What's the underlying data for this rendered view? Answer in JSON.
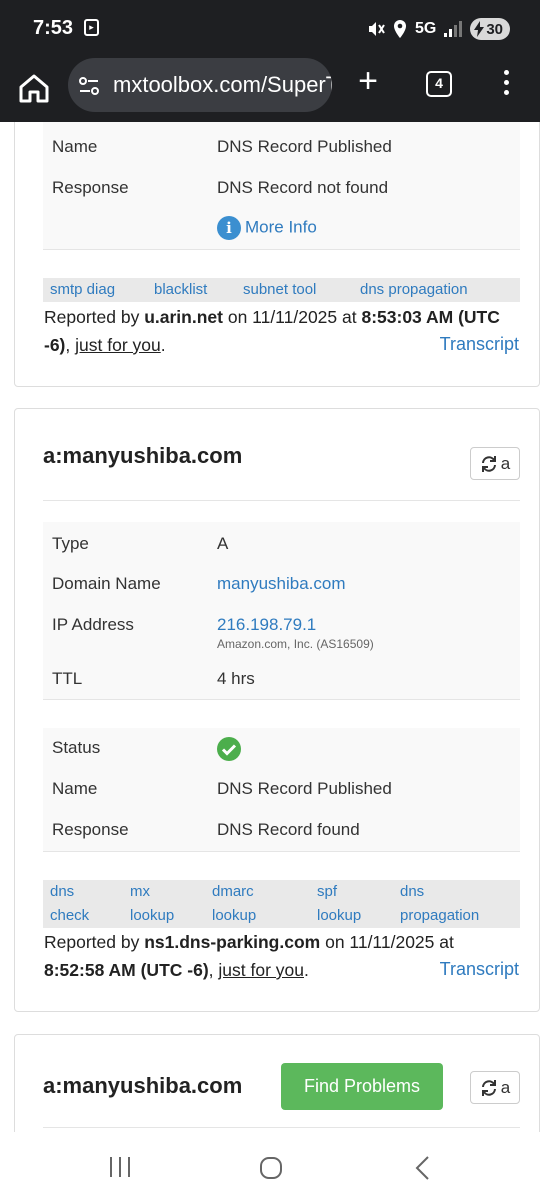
{
  "status_bar": {
    "time": "7:53",
    "network": "5G",
    "battery": "30"
  },
  "browser": {
    "url": "mxtoolbox.com/SuperTool",
    "tab_count": "4"
  },
  "card1": {
    "rows": [
      {
        "label": "Name",
        "value": "DNS Record Published"
      },
      {
        "label": "Response",
        "value": "DNS Record not found"
      }
    ],
    "more_info": "More Info",
    "links": [
      "smtp diag",
      "blacklist",
      "subnet tool",
      "dns propagation"
    ],
    "reported": {
      "prefix": "Reported by ",
      "server": "u.arin.net",
      "on": " on 11/11/2025 at ",
      "time": "8:53:03 AM (UTC -6)",
      "sep": ", ",
      "just": "just for you",
      "end": "."
    },
    "transcript": "Transcript"
  },
  "card2": {
    "title": "a:manyushiba.com",
    "refresh_label": "a",
    "record": [
      {
        "label": "Type",
        "value": "A"
      },
      {
        "label": "Domain Name",
        "value": "manyushiba.com"
      },
      {
        "label": "IP Address",
        "value": "216.198.79.1",
        "sub": "Amazon.com, Inc. (AS16509)"
      },
      {
        "label": "TTL",
        "value": "4 hrs"
      }
    ],
    "status": [
      {
        "label": "Status"
      },
      {
        "label": "Name",
        "value": "DNS Record Published"
      },
      {
        "label": "Response",
        "value": "DNS Record found"
      }
    ],
    "links": [
      {
        "l1": "dns",
        "l2": "check"
      },
      {
        "l1": "mx",
        "l2": "lookup"
      },
      {
        "l1": "dmarc",
        "l2": "lookup"
      },
      {
        "l1": "spf",
        "l2": "lookup"
      },
      {
        "l1": "dns",
        "l2": "propagation"
      }
    ],
    "reported": {
      "prefix": "Reported by ",
      "server": "ns1.dns-parking.com",
      "on": " on 11/11/2025 at",
      "time": "8:52:58 AM (UTC -6)",
      "sep": ", ",
      "just": "just for you",
      "end": "."
    },
    "transcript": "Transcript"
  },
  "card3": {
    "title": "a:manyushiba.com",
    "find_problems": "Find Problems",
    "refresh_label": "a"
  },
  "colors": {
    "link": "#2f7bbf",
    "green": "#5cb85c",
    "chrome": "#1e1f22"
  }
}
